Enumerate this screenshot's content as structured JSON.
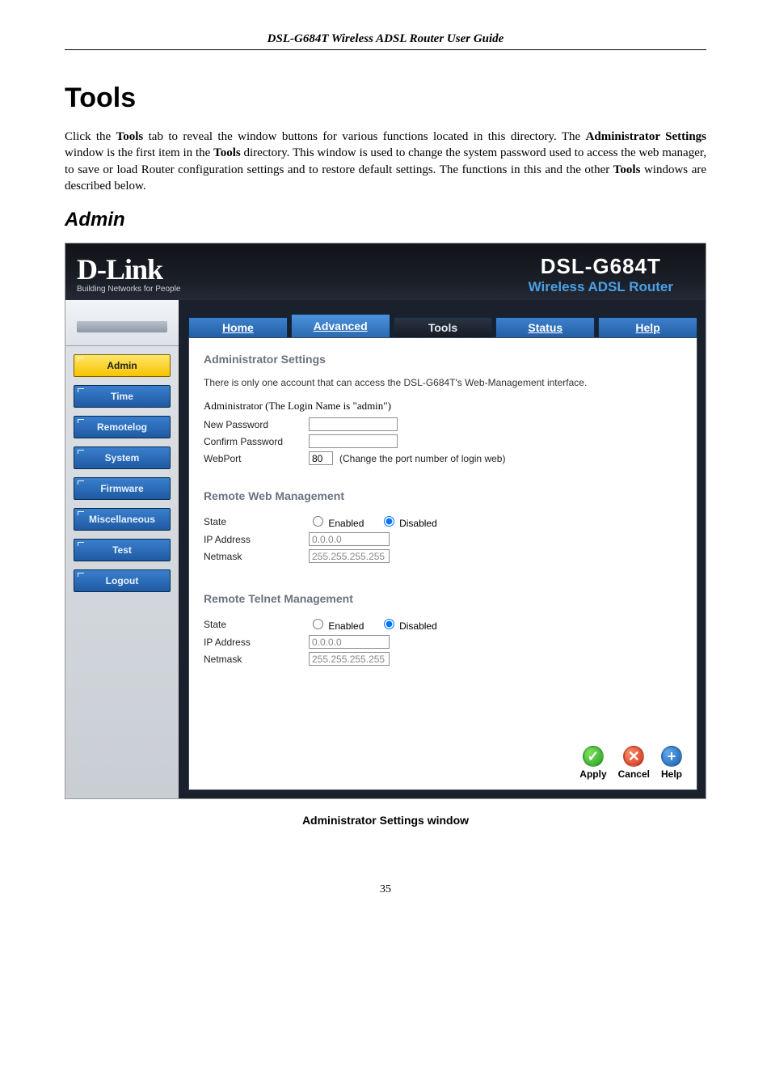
{
  "doc": {
    "header": "DSL-G684T Wireless ADSL Router User Guide",
    "section_title": "Tools",
    "body_html": "Click the <b>Tools</b> tab to reveal the window buttons for various functions located in this directory. The <b>Administrator Settings</b> window is the first item in the <b>Tools</b> directory. This window is used to change the system password used to access the web manager, to save or load Router configuration settings and to restore default settings. The functions in this and the other <b>Tools</b> windows are described below.",
    "subsection_title": "Admin",
    "caption": "Administrator Settings window",
    "page_number": "35"
  },
  "router": {
    "logo_main": "D-Link",
    "logo_tag": "Building Networks for People",
    "product_model": "DSL-G684T",
    "product_desc": "Wireless ADSL Router",
    "tabs": {
      "home": "Home",
      "advanced": "Advanced",
      "tools": "Tools",
      "status": "Status",
      "help": "Help"
    },
    "side": {
      "admin": "Admin",
      "time": "Time",
      "remotelog": "Remotelog",
      "system": "System",
      "firmware": "Firmware",
      "misc": "Miscellaneous",
      "test": "Test",
      "logout": "Logout"
    },
    "admin": {
      "section": "Administrator Settings",
      "note": "There is only one account that can access the DSL-G684T's Web-Management interface.",
      "login_line": "Administrator (The Login Name is \"admin\")",
      "new_pw": "New Password",
      "confirm_pw": "Confirm Password",
      "webport_label": "WebPort",
      "webport_value": "80",
      "webport_hint": "(Change the port number of login web)"
    },
    "rwm": {
      "section": "Remote Web Management",
      "state": "State",
      "enabled": "Enabled",
      "disabled": "Disabled",
      "ip_label": "IP Address",
      "ip_value": "0.0.0.0",
      "nm_label": "Netmask",
      "nm_value": "255.255.255.255"
    },
    "rtm": {
      "section": "Remote Telnet Management",
      "state": "State",
      "enabled": "Enabled",
      "disabled": "Disabled",
      "ip_label": "IP Address",
      "ip_value": "0.0.0.0",
      "nm_label": "Netmask",
      "nm_value": "255.255.255.255"
    },
    "actions": {
      "apply": "Apply",
      "cancel": "Cancel",
      "help": "Help"
    }
  }
}
